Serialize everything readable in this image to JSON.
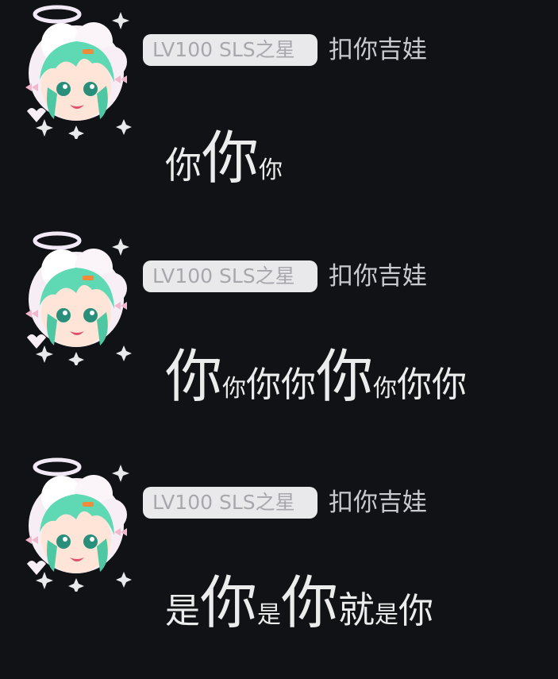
{
  "messages": [
    {
      "badge": "LV100 SLS之星",
      "username": "扣你吉娃",
      "content": [
        {
          "text": "你",
          "size": "mid"
        },
        {
          "text": "你",
          "size": "big"
        },
        {
          "text": "你",
          "size": "small"
        }
      ]
    },
    {
      "badge": "LV100 SLS之星",
      "username": "扣你吉娃",
      "content": [
        {
          "text": "你",
          "size": "big"
        },
        {
          "text": "你",
          "size": "small"
        },
        {
          "text": "你你",
          "size": "norm"
        },
        {
          "text": "你",
          "size": "big"
        },
        {
          "text": "你",
          "size": "small"
        },
        {
          "text": "你你",
          "size": "norm"
        }
      ]
    },
    {
      "badge": "LV100 SLS之星",
      "username": "扣你吉娃",
      "content": [
        {
          "text": "是",
          "size": "norm"
        },
        {
          "text": "你",
          "size": "big"
        },
        {
          "text": "是",
          "size": "small"
        },
        {
          "text": "你",
          "size": "big"
        },
        {
          "text": "就",
          "size": "mid"
        },
        {
          "text": "是",
          "size": "small"
        },
        {
          "text": "你",
          "size": "norm"
        }
      ]
    }
  ],
  "icons": {
    "avatar": "anime-avatar-icon"
  },
  "colors": {
    "background": "#111215",
    "badge_bg": "#e9e9ec",
    "badge_text": "#a7a7ad",
    "username": "#c9c9cf",
    "content": "#ececec",
    "hair": "#5fd9b4"
  }
}
